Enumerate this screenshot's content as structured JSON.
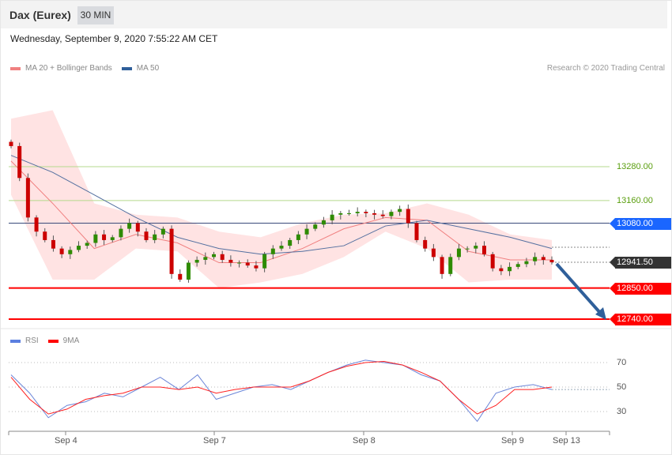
{
  "header": {
    "title": "Dax (Eurex)",
    "timeframe": "30 MIN"
  },
  "timestamp": "Wednesday, September 9, 2020 7:55:22 AM CET",
  "legend": {
    "ma20": "MA 20 + Bollinger Bands",
    "ma50": "MA 50",
    "rsi": "RSI",
    "ma9": "9MA"
  },
  "credit": "Research © 2020 Trading Central",
  "colors": {
    "up": "#2e8b00",
    "down": "#cc0000",
    "band": "#ffe3e3",
    "ma20": "#f08080",
    "ma50": "#5470a0",
    "resist": "#b5d98c",
    "support": "#ff0000",
    "pivot": "#1a66ff",
    "arrow": "#2f5f9a"
  },
  "levels": {
    "r2": "13280.00",
    "r1": "13160.00",
    "pivot": "13080.00",
    "last": "12941.50",
    "s1": "12850.00",
    "s2": "12740.00"
  },
  "rsi_ticks": [
    "70",
    "50",
    "30"
  ],
  "x_labels": [
    "Sep 4",
    "Sep 7",
    "Sep 8",
    "Sep 9",
    "Sep 13"
  ],
  "chart_data": {
    "type": "candlestick",
    "ylim": [
      12740,
      13280
    ],
    "closes": [
      13353,
      13240,
      13100,
      13050,
      13020,
      12990,
      12970,
      12985,
      13000,
      13010,
      13040,
      13020,
      13030,
      13060,
      13080,
      13050,
      13020,
      13040,
      13060,
      12900,
      12880,
      12940,
      12950,
      12960,
      12970,
      12950,
      12940,
      12940,
      12930,
      12920,
      12970,
      12990,
      13000,
      13020,
      13040,
      13060,
      13075,
      13090,
      13110,
      13115,
      13115,
      13120,
      13115,
      13110,
      13105,
      13120,
      13130,
      13080,
      13020,
      12990,
      12960,
      12900,
      12960,
      12990,
      12990,
      13000,
      12970,
      12920,
      12910,
      12925,
      12935,
      12945,
      12960,
      12950,
      12941.5
    ],
    "bb_upper": [
      13450,
      13480,
      13150,
      13110,
      13100,
      13050,
      13030,
      13080,
      13110,
      13115,
      13150,
      13110,
      13040,
      13020
    ],
    "bb_lower": [
      13180,
      12880,
      12880,
      12990,
      12980,
      12850,
      12870,
      12900,
      12960,
      13050,
      12990,
      12870,
      12880,
      12880
    ],
    "ma20": [
      13300,
      13150,
      12990,
      13040,
      13010,
      12940,
      12940,
      12990,
      13060,
      13100,
      13090,
      12980,
      12950,
      12950
    ],
    "ma50": [
      13320,
      13260,
      13180,
      13100,
      13030,
      12990,
      12970,
      12980,
      13000,
      13070,
      13090,
      13060,
      13030,
      12990
    ],
    "rsi": [
      60,
      45,
      25,
      35,
      38,
      45,
      42,
      50,
      58,
      48,
      60,
      40,
      45,
      50,
      52,
      48,
      55,
      62,
      68,
      72,
      70,
      68,
      60,
      55,
      40,
      22,
      45,
      50,
      52,
      48
    ],
    "rsi_ma9": [
      58,
      40,
      28,
      32,
      40,
      43,
      45,
      50,
      50,
      48,
      50,
      45,
      48,
      50,
      50,
      50,
      55,
      62,
      67,
      70,
      71,
      68,
      62,
      55,
      40,
      28,
      35,
      48,
      48,
      50
    ],
    "forecast_target": 12740
  }
}
